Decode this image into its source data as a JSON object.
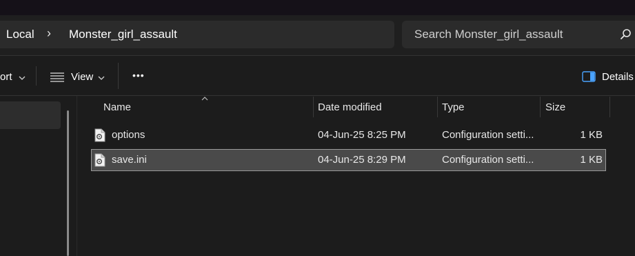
{
  "address": {
    "crumbs": [
      "Local",
      "Monster_girl_assault"
    ],
    "separator": "›"
  },
  "search": {
    "placeholder": "Search Monster_girl_assault",
    "icon": "search-icon"
  },
  "toolbar": {
    "sort_label": "ort",
    "view_label": "View",
    "more_label": "•••",
    "details_label": "Details"
  },
  "columns": {
    "name": "Name",
    "date": "Date modified",
    "type": "Type",
    "size": "Size"
  },
  "files": [
    {
      "name": "options",
      "date": "04-Jun-25 8:25 PM",
      "type": "Configuration setti...",
      "size": "1 KB",
      "selected": false
    },
    {
      "name": "save.ini",
      "date": "04-Jun-25 8:29 PM",
      "type": "Configuration setti...",
      "size": "1 KB",
      "selected": true
    }
  ],
  "colors": {
    "background": "#1c1c1c",
    "surface": "#2b2b2b",
    "selection": "#4a4a4a",
    "details_accent": "#4aa3ff"
  }
}
